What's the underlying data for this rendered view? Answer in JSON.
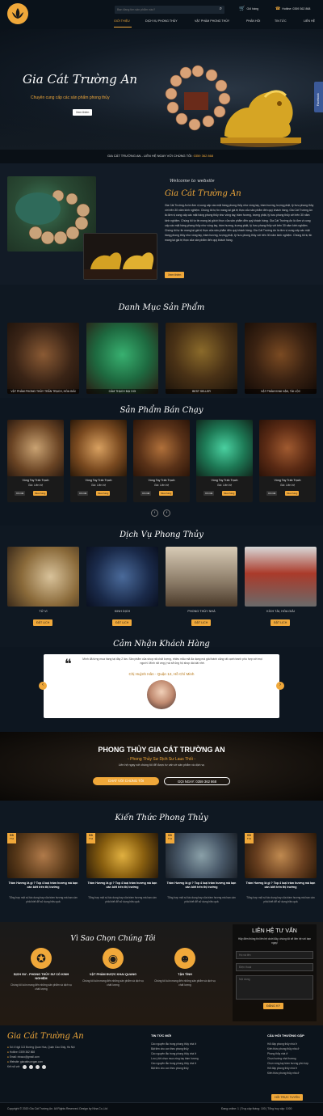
{
  "header": {
    "search_placeholder": "Bạn đang tìm sản phẩm nào?",
    "cart_label": "Giỏ hàng",
    "hotline": "Hotline: 0359 362 868",
    "nav": [
      "GIỚI THIỆU",
      "DỊCH VỤ PHONG THỦY",
      "VẬT PHẨM PHONG THỦY",
      "PHẢN HỒI",
      "TIN TỨC",
      "LIÊN HỆ"
    ]
  },
  "hero": {
    "title": "Gia Cát Trường An",
    "subtitle": "Chuyên cung cấp các sản phẩm phong thủy",
    "button": "Xem thêm",
    "facebook": "Facebook"
  },
  "ticker": {
    "text": "GIA CÁT TRƯỜNG AN - LIÊN HỆ NGAY VỚI CHÚNG TÔI:",
    "phone": "0359 362 868"
  },
  "about": {
    "welcome": "Welcome to website",
    "title": "Gia Cát Trường An",
    "body": "Gia Cát Trường An là đơn vị cung cấp các mặt hàng phong thủy như vòng tay, trầm hương, tượng phật, tỳ hưu phong thủy với trên 30 năm kinh nghiệm. Chúng tôi tự tin mang lại giá trị thực của sản phẩm đến quý khách hàng. Gia Cát Trường An là đơn vị cung cấp các mặt hàng phong thủy như vòng tay, trầm hương, tượng phật, tỳ hưu phong thủy với trên 30 năm kinh nghiệm. Chúng tôi tự tin mang lại giá trị thực của sản phẩm đến quý khách hàng. Gia Cát Trường An là đơn vị cung cấp các mặt hàng phong thủy như vòng tay, trầm hương, tượng phật, tỳ hưu phong thủy với trên 30 năm kinh nghiệm. Chúng tôi tự tin mang lại giá trị thực của sản phẩm đến quý khách hàng. Gia Cát Trường An là đơn vị cung cấp các mặt hàng phong thủy như vòng tay, trầm hương, tượng phật, tỳ hưu phong thủy với trên 30 năm kinh nghiệm. Chúng tôi tự tin mang lại giá trị thực của sản phẩm đến quý khách hàng.",
    "button": "Xem thêm"
  },
  "categories": {
    "title": "Danh Mục Sản Phẩm",
    "items": [
      "VẬT PHẨM PHONG THỦY TRẤN TRẠCH, HÓA GIẢI",
      "CẨM THẠCH ĐẠI DOI",
      "BEST SELLER",
      "VẬT PHẨM KHAI VẬN, TÀI LỘC"
    ]
  },
  "bestsellers": {
    "title": "Sản Phẩm Bán Chạy",
    "items": [
      {
        "name": "Vòng Tay Trấn Trạch",
        "price": "Giá: Liên hệ"
      },
      {
        "name": "Vòng Tay Trấn Trạch",
        "price": "Giá: Liên hệ"
      },
      {
        "name": "Vòng Tay Trấn Trạch",
        "price": "Giá: Liên hệ"
      },
      {
        "name": "Vòng Tay Trấn Trạch",
        "price": "Giá: Liên hệ"
      },
      {
        "name": "Vòng Tay Trấn Trạch",
        "price": "Giá: Liên hệ"
      }
    ],
    "detail": "Chi tiết",
    "buy": "Mua hàng"
  },
  "services": {
    "title": "Dịch Vụ Phong Thủy",
    "items": [
      "TỬ VI",
      "KINH DỊCH",
      "PHONG THỦY NHÀ",
      "KÍCH TÀI, HÓA GIẢI"
    ],
    "button": "ĐẶT LỊCH"
  },
  "testimonials": {
    "title": "Cảm Nhận Khách Hàng",
    "quote": "Mình đã từng mua hàng tại đây 2 lần. Sản phẩm của shop rất chất lượng, nhiều mẫu mã đa dạng mà giá thành cũng rất cạnh tranh phù hợp với mọi người. Mình rất ưng ý và sẽ ủng hộ shop dài dài nhé.",
    "name": "Chị Huỳnh Hân - Quận 12, Hồ Chí Minh"
  },
  "cta": {
    "title": "PHONG THỦY GIA CÁT TRƯỜNG AN",
    "subtitle": "- Phong Thủy Sư Dịch Sư Laus Thối -",
    "text": "Liên hệ ngay với chúng tôi để được tư vấn về sản phẩm và dịch vụ",
    "button1": "CHAT VỚI CHÚNG TÔI",
    "button2": "GỌI NGAY: 0359 362 868"
  },
  "knowledge": {
    "title": "Kiến Thức Phong Thủy",
    "items": [
      {
        "date": "03",
        "month": "Th4",
        "title": "Trầm Hương là gì ? Top 4 loại trầm hương mà bạn cần biết trên thị trường",
        "desc": "Tổng hợp một số tác dụng hay của trầm hương mà bạn cần phải biết để sử dụng hiệu quả"
      },
      {
        "date": "03",
        "month": "Th4",
        "title": "Trầm Hương là gì ? Top 4 loại trầm hương mà bạn cần biết trên thị trường",
        "desc": "Tổng hợp một số tác dụng hay của trầm hương mà bạn cần phải biết để sử dụng hiệu quả"
      },
      {
        "date": "03",
        "month": "Th4",
        "title": "Trầm Hương là gì ? Top 4 loại trầm hương mà bạn cần biết trên thị trường",
        "desc": "Tổng hợp một số tác dụng hay của trầm hương mà bạn cần phải biết để sử dụng hiệu quả"
      },
      {
        "date": "03",
        "month": "Th4",
        "title": "Trầm Hương là gì ? Top 4 loại trầm hương mà bạn cần biết trên thị trường",
        "desc": "Tổng hợp một số tác dụng hay của trầm hương mà bạn cần phải biết để sử dụng hiệu quả"
      }
    ]
  },
  "why": {
    "title": "Vì Sao Chọn Chúng Tôi",
    "items": [
      {
        "title": "DỊCH SƯ - PHONG THỦY SƯ CÓ KINH NGHIỆM",
        "desc": "Chúng tôi luôn mang đến những sản phẩm và dịch vụ chất lượng"
      },
      {
        "title": "VẬT PHẨM ĐƯỢC KHAI QUANG",
        "desc": "Chúng tôi luôn mang đến những sản phẩm và dịch vụ chất lượng"
      },
      {
        "title": "TẬN TÌNH",
        "desc": "Chúng tôi luôn mang đến những sản phẩm và dịch vụ chất lượng"
      }
    ]
  },
  "contact_form": {
    "title": "LIÊN HỆ TƯ VẤN",
    "desc": "Hãy điền thông tin liên hệ dưới đây, chúng tôi sẽ liên hệ với bạn ngay!",
    "name": "Họ và tên",
    "phone": "Điện thoại",
    "message": "Nội dung",
    "button": "ĐĂNG KÝ"
  },
  "footer": {
    "brand": "Gia Cát Trường An",
    "address": "Số 4 Ngõ 113 Đường Quan Hoa, Quận Cầu Giấy, Hà Nội",
    "hotline": "Hotline: 0359 362 868",
    "email": "Email: ninaco@gmail.com",
    "website": "Website: giacattruongan.com",
    "connect": "Kết nối với:",
    "news_title": "TIN TỨC MỚI",
    "news": [
      "Các nguyên tắc trong phong thủy nhà ở",
      "Bật tiền cho con theo phong thủy",
      "Các nguyên tắc trong phong thủy nhà ở",
      "Lưu ý khi chọn mua vòng tay trầm hương",
      "Các nguyên tắc trong phong thủy nhà ở",
      "Bật tiền cho con theo phong thủy"
    ],
    "faq_title": "CÂU HỎI THƯỜNG GẶP",
    "faq": [
      "Hỏi đáp phong thủy nhà ở",
      "Kiến thức phong thủy nhà ở",
      "Phong thủy nhà ở",
      "Chọn hướng nhà thương",
      "Chọn vòng tay trầm hương phù hợp",
      "Hỏi đáp phong thủy nhà ở",
      "Kiến thức phong thủy nhà ở"
    ],
    "faq_button": "HỎI TRỰC TUYẾN",
    "copyright": "Copyright © 2020 Gia Cát Trường An. All Rights Reserved. Design by Nina Co.,Ltd",
    "stats": "Đang online: 1  |  Truy cập tháng: 100  |  Tổng truy cập: 1000"
  },
  "watermark": "NiNa Co.,Ltd",
  "colors": {
    "accent": "#f0a83a",
    "bg": "#0d1620",
    "text": "#e8e8e8"
  }
}
